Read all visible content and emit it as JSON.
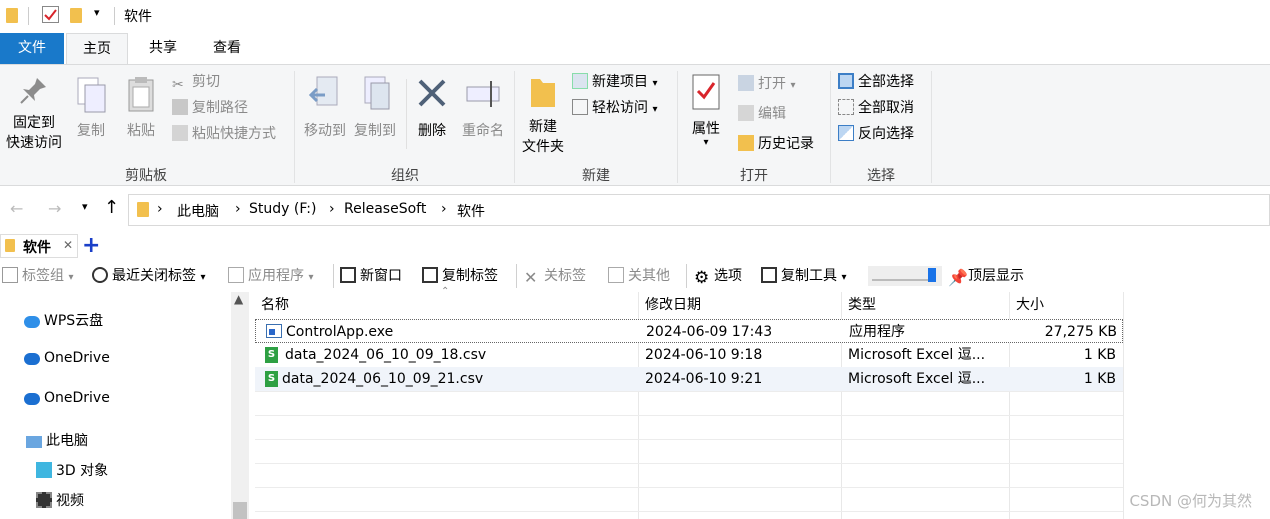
{
  "title_bar": {
    "title": "软件"
  },
  "ribbon_tabs": [
    "文件",
    "主页",
    "共享",
    "查看"
  ],
  "ribbon": {
    "clipboard": {
      "pin_line1": "固定到",
      "pin_line2": "快速访问",
      "copy": "复制",
      "paste": "粘贴",
      "cut": "剪切",
      "copy_path": "复制路径",
      "paste_shortcut": "粘贴快捷方式",
      "label": "剪贴板"
    },
    "organize": {
      "move_to": "移动到",
      "copy_to": "复制到",
      "delete": "删除",
      "rename": "重命名",
      "label": "组织"
    },
    "new": {
      "new_folder_line1": "新建",
      "new_folder_line2": "文件夹",
      "new_item": "新建项目",
      "easy_access": "轻松访问",
      "label": "新建"
    },
    "open": {
      "properties": "属性",
      "open": "打开",
      "edit": "编辑",
      "history": "历史记录",
      "label": "打开"
    },
    "select": {
      "select_all": "全部选择",
      "select_none": "全部取消",
      "invert": "反向选择",
      "label": "选择"
    }
  },
  "address": {
    "crumbs": [
      "此电脑",
      "Study (F:)",
      "ReleaseSoft",
      "软件"
    ]
  },
  "tab_strip": {
    "tab_label": "软件",
    "add": "+"
  },
  "toolbar": {
    "tab_group": "标签组",
    "recent_closed": "最近关闭标签",
    "apps": "应用程序",
    "new_window": "新窗口",
    "copy_tab": "复制标签",
    "close_tab": "关标签",
    "close_others": "关其他",
    "options": "选项",
    "copy_tool": "复制工具",
    "on_top": "顶层显示"
  },
  "nav": {
    "items": [
      "WPS云盘",
      "OneDrive",
      "OneDrive",
      "此电脑",
      "3D 对象",
      "视频"
    ]
  },
  "file_list": {
    "columns": [
      "名称",
      "修改日期",
      "类型",
      "大小"
    ],
    "rows": [
      {
        "name": "ControlApp.exe",
        "date": "2024-06-09 17:43",
        "type": "应用程序",
        "size": "27,275 KB"
      },
      {
        "name": "data_2024_06_10_09_18.csv",
        "date": "2024-06-10 9:18",
        "type": "Microsoft Excel 逗...",
        "size": "1 KB"
      },
      {
        "name": "data_2024_06_10_09_21.csv",
        "date": "2024-06-10 9:21",
        "type": "Microsoft Excel 逗...",
        "size": "1 KB"
      }
    ]
  },
  "watermark": "CSDN @何为其然",
  "colors": {
    "file_tab": "#1979ca",
    "ribbon_bg": "#f5f6f7",
    "folder": "#f2c04e",
    "selection": "#e5f3ff"
  }
}
